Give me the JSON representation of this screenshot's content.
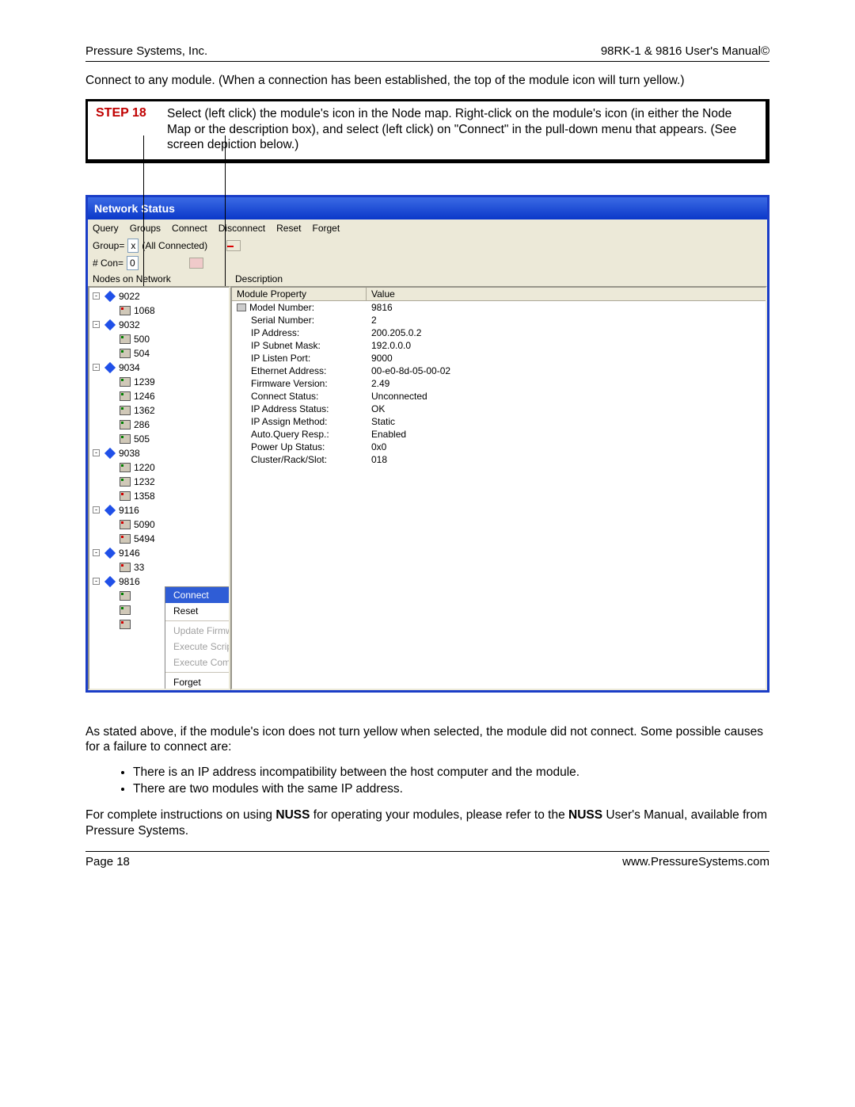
{
  "header": {
    "left": "Pressure Systems, Inc.",
    "right": "98RK-1 & 9816 User's Manual©"
  },
  "footer": {
    "left": "Page 18",
    "right": "www.PressureSystems.com"
  },
  "intro": "Connect to any module. (When a connection has been established, the top of the module icon will turn yellow.)",
  "step": {
    "label": "STEP 18",
    "text": "Select (left click) the module's icon in the Node map. Right-click on the module's icon (in either the Node Map or the description box), and select (left click) on \"Connect\" in the pull-down menu that appears. (See screen depiction below.)"
  },
  "win": {
    "title": "Network Status",
    "menu": [
      "Query",
      "Groups",
      "Connect",
      "Disconnect",
      "Reset",
      "Forget"
    ],
    "toolbar": {
      "group_label": "Group=",
      "group_value": "x",
      "group_suffix": "(All Connected)",
      "con_label": "# Con=",
      "con_value": "0"
    },
    "left_title": "Nodes on Network",
    "right_title": "Description",
    "prop_header": {
      "col1": "Module Property",
      "col2": "Value"
    },
    "props": [
      {
        "label": "Model Number:",
        "value": "9816",
        "icon": true
      },
      {
        "label": "Serial Number:",
        "value": "2"
      },
      {
        "label": "IP Address:",
        "value": "200.205.0.2"
      },
      {
        "label": "IP Subnet Mask:",
        "value": "192.0.0.0"
      },
      {
        "label": "IP Listen Port:",
        "value": "9000"
      },
      {
        "label": "Ethernet Address:",
        "value": "00-e0-8d-05-00-02"
      },
      {
        "label": "Firmware Version:",
        "value": "2.49"
      },
      {
        "label": "Connect Status:",
        "value": "Unconnected"
      },
      {
        "label": "IP Address Status:",
        "value": "OK"
      },
      {
        "label": "IP Assign Method:",
        "value": "Static"
      },
      {
        "label": "Auto.Query Resp.:",
        "value": "Enabled"
      },
      {
        "label": "Power Up Status:",
        "value": "0x0"
      },
      {
        "label": "Cluster/Rack/Slot:",
        "value": "018"
      }
    ],
    "tree": [
      {
        "type": "parent",
        "label": "9022"
      },
      {
        "type": "child",
        "label": "1068",
        "color": "red"
      },
      {
        "type": "parent",
        "label": "9032"
      },
      {
        "type": "child",
        "label": "500",
        "color": "green"
      },
      {
        "type": "child",
        "label": "504",
        "color": "green"
      },
      {
        "type": "parent",
        "label": "9034"
      },
      {
        "type": "child",
        "label": "1239",
        "color": "green"
      },
      {
        "type": "child",
        "label": "1246",
        "color": "green"
      },
      {
        "type": "child",
        "label": "1362",
        "color": "green"
      },
      {
        "type": "child",
        "label": "286",
        "color": "green"
      },
      {
        "type": "child",
        "label": "505",
        "color": "green"
      },
      {
        "type": "parent",
        "label": "9038"
      },
      {
        "type": "child",
        "label": "1220",
        "color": "green"
      },
      {
        "type": "child",
        "label": "1232",
        "color": "green"
      },
      {
        "type": "child",
        "label": "1358",
        "color": "red"
      },
      {
        "type": "parent",
        "label": "9116"
      },
      {
        "type": "child",
        "label": "5090",
        "color": "red"
      },
      {
        "type": "child",
        "label": "5494",
        "color": "red"
      },
      {
        "type": "parent",
        "label": "9146"
      },
      {
        "type": "child",
        "label": "33",
        "color": "red"
      },
      {
        "type": "parent",
        "label": "9816"
      },
      {
        "type": "child",
        "label": "",
        "color": "green"
      },
      {
        "type": "child",
        "label": "",
        "color": "green"
      },
      {
        "type": "child",
        "label": "",
        "color": "red"
      }
    ],
    "context_menu": {
      "items": [
        {
          "label": "Connect",
          "state": "highlight"
        },
        {
          "label": "Reset",
          "state": "normal"
        },
        {
          "label": "Update Firmware",
          "state": "disabled"
        },
        {
          "label": "Execute Script",
          "state": "disabled"
        },
        {
          "label": "Execute Commands",
          "state": "disabled"
        },
        {
          "label": "Forget",
          "state": "normal"
        }
      ]
    }
  },
  "after1": "As stated above, if the module's icon does not turn yellow when selected, the module did not connect. Some possible causes for a failure to connect are:",
  "bullets": [
    "There is an IP address incompatibility between the host computer and the module.",
    "There are two modules with the same IP address."
  ],
  "after2a": "For complete instructions on using ",
  "after2b": "NUSS",
  "after2c": " for operating your modules, please refer to the ",
  "after2d": "NUSS",
  "after2e": " User's Manual, available from Pressure Systems."
}
